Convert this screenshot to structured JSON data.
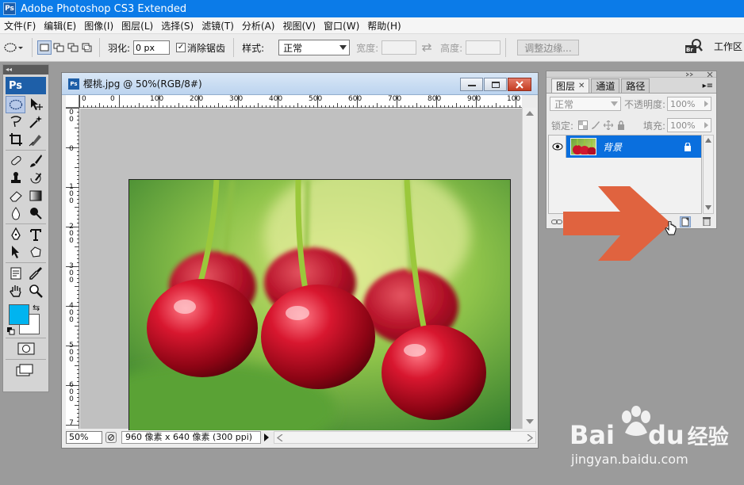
{
  "app": {
    "title": "Adobe Photoshop CS3 Extended",
    "badge": "Ps"
  },
  "menu": [
    "文件(F)",
    "编辑(E)",
    "图像(I)",
    "图层(L)",
    "选择(S)",
    "滤镜(T)",
    "分析(A)",
    "视图(V)",
    "窗口(W)",
    "帮助(H)"
  ],
  "options": {
    "feather_label": "羽化:",
    "feather_value": "0 px",
    "antialias_label": "消除锯齿",
    "antialias_checked": "✓",
    "style_label": "样式:",
    "style_value": "正常",
    "width_label": "宽度:",
    "height_label": "高度:",
    "refine_button": "调整边缘...",
    "workspace_label": "工作区",
    "bridge_badge": "Br"
  },
  "tools": {
    "logo": "Ps",
    "header_arrows": "◂◂"
  },
  "document": {
    "title": "樱桃.jpg @ 50%(RGB/8#)",
    "ps_badge": "Ps",
    "zoom": "50%",
    "info": "960 像素 x 640 像素 (300 ppi)",
    "ruler_h_labels": [
      "0",
      "0",
      "100",
      "200",
      "300",
      "400",
      "500",
      "600",
      "700",
      "800",
      "900",
      "100"
    ],
    "ruler_v_labels": [
      "0 0",
      "0",
      "1 0 0",
      "2 0 0",
      "3 0 0",
      "4 0 0",
      "5 0 0",
      "6 0 0",
      "7"
    ]
  },
  "layers_panel": {
    "tabs": [
      "图层",
      "通道",
      "路径"
    ],
    "active_tab": "图层",
    "blend_mode": "正常",
    "opacity_label": "不透明度:",
    "opacity_value": "100%",
    "lock_label": "锁定:",
    "fill_label": "填充:",
    "fill_value": "100%",
    "layer_name": "背景",
    "menu_icon": "▸≡"
  },
  "watermark": {
    "brand": "Bai",
    "brand2": "du",
    "brand3": "经验",
    "url": "jingyan.baidu.com"
  },
  "colors": {
    "titlebar": "#0b7be8",
    "layer_selected": "#0a6fde",
    "arrow": "#e0633f",
    "foreground": "#00b4f0",
    "background_swatch": "#ffffff"
  }
}
